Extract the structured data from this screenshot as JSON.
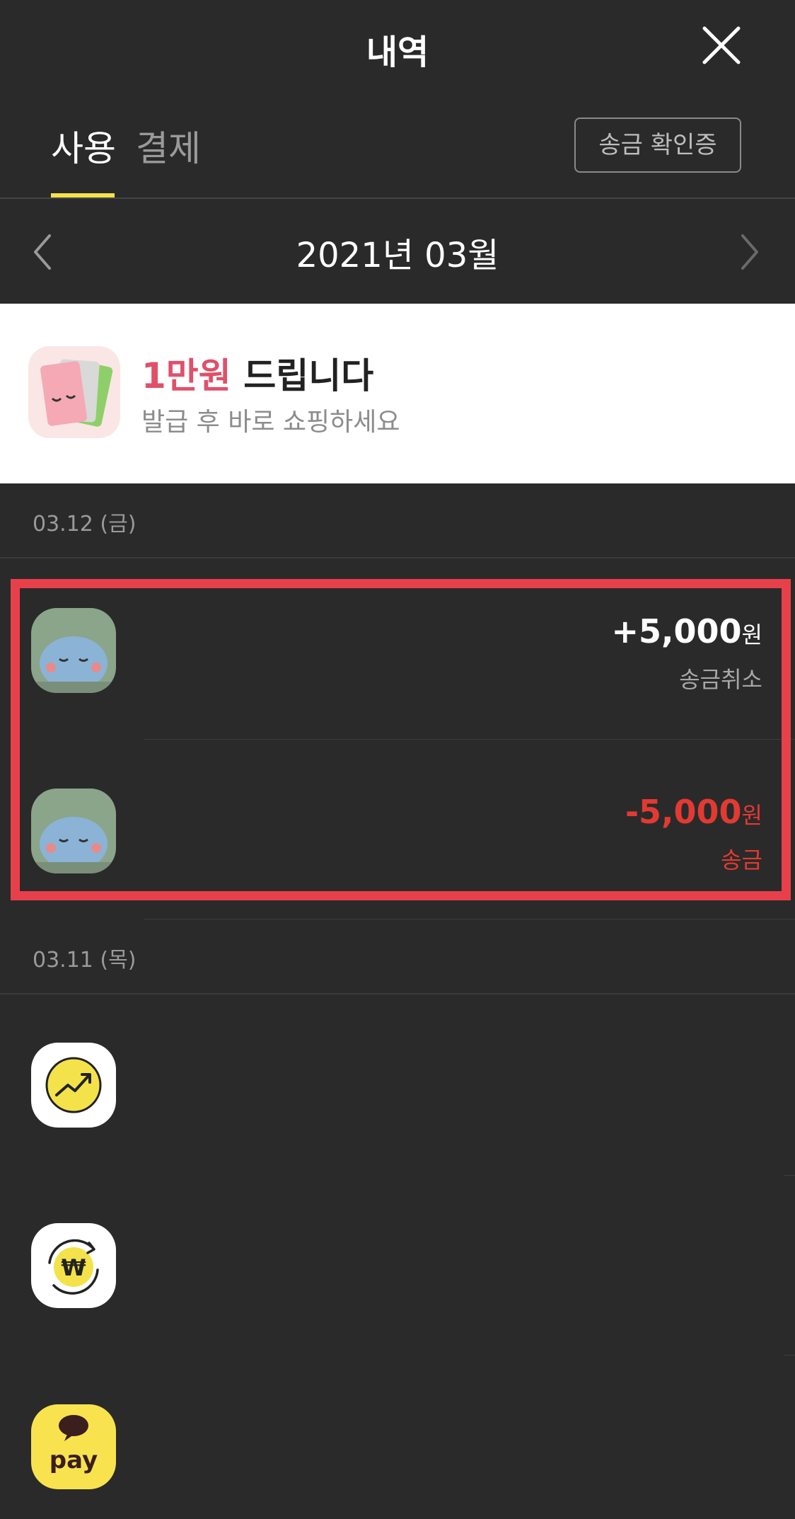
{
  "header": {
    "title": "내역"
  },
  "tabs": [
    {
      "label": "사용",
      "active": true
    },
    {
      "label": "결제",
      "active": false
    }
  ],
  "transfer_certificate_label": "송금 확인증",
  "month_nav": {
    "label": "2021년 03월"
  },
  "banner": {
    "title_highlight": "1만원",
    "title_rest": " 드립니다",
    "subtitle": "발급 후 바로 쇼핑하세요"
  },
  "groups": [
    {
      "date": "03.12 (금)",
      "transactions": [
        {
          "amount": "+5,000",
          "unit": "원",
          "label": "송금취소",
          "direction": "positive"
        },
        {
          "amount": "-5,000",
          "unit": "원",
          "label": "송금",
          "direction": "negative"
        }
      ]
    },
    {
      "date": "03.11 (목)",
      "transactions": [
        {
          "icon": "investment-icon"
        },
        {
          "icon": "won-exchange-icon"
        },
        {
          "icon": "kakao-pay-icon",
          "icon_text": "pay"
        }
      ]
    }
  ],
  "colors": {
    "background": "#2a2a2a",
    "accent_yellow": "#f4e24b",
    "negative_red": "#e23a32",
    "highlight_border": "#e8404a",
    "banner_highlight": "#e0506a"
  }
}
